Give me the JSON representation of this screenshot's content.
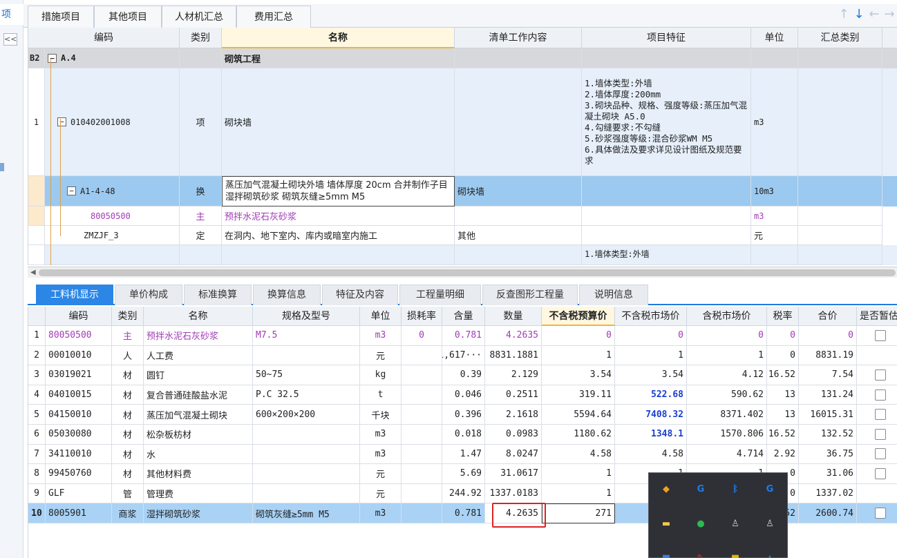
{
  "sidebar": {
    "selected_label": "项",
    "collapse_glyph": "<<",
    "marker_label": ""
  },
  "top_tabs": [
    "措施项目",
    "其他项目",
    "人材机汇总",
    "费用汇总"
  ],
  "nav_arrows": [
    "↑",
    "↓",
    "←",
    "→"
  ],
  "upper_grid": {
    "headers": {
      "code": "编码",
      "type": "类别",
      "name": "名称",
      "work": "清单工作内容",
      "feature": "项目特征",
      "unit": "单位",
      "summary": "汇总类别"
    },
    "rows": [
      {
        "no": "B2",
        "code": "A.4",
        "type": "",
        "name": "砌筑工程",
        "work": "",
        "feature": "",
        "unit": "",
        "summary": ""
      },
      {
        "no": "1",
        "code": "010402001008",
        "type": "项",
        "name": "砌块墙",
        "work": "",
        "feature": "1.墙体类型:外墙\n2.墙体厚度:200mm\n3.砌块品种、规格、强度等级:蒸压加气混凝土砌块 A5.0\n4.勾缝要求:不勾缝\n5.砂浆强度等级:混合砂浆WM M5\n6.具体做法及要求详见设计图纸及规范要求",
        "unit": "m3",
        "summary": ""
      },
      {
        "no": "",
        "code": "A1-4-48",
        "type": "换",
        "name": "蒸压加气混凝土砌块外墙 墙体厚度 20cm 合并制作子目 湿拌砌筑砂浆 砌筑灰缝≥5mm M5",
        "work": "砌块墙",
        "feature": "",
        "unit": "10m3",
        "summary": ""
      },
      {
        "no": "",
        "code": "80050500",
        "type": "主",
        "name": "预拌水泥石灰砂浆",
        "work": "",
        "feature": "",
        "unit": "m3",
        "summary": ""
      },
      {
        "no": "",
        "code": "ZMZJF_3",
        "type": "定",
        "name": "在洞内、地下室内、库内或暗室内施工",
        "work": "其他",
        "feature": "",
        "unit": "元",
        "summary": ""
      },
      {
        "no": "",
        "code": "",
        "type": "",
        "name": "",
        "work": "",
        "feature": "1.墙体类型:外墙",
        "unit": "",
        "summary": ""
      }
    ]
  },
  "lower_tabs": [
    "工料机显示",
    "单价构成",
    "标准换算",
    "换算信息",
    "特征及内容",
    "工程量明细",
    "反查图形工程量",
    "说明信息"
  ],
  "lower_grid": {
    "headers": [
      "",
      "编码",
      "类别",
      "名称",
      "规格及型号",
      "单位",
      "损耗率",
      "含量",
      "数量",
      "不含税预算价",
      "不含税市场价",
      "含税市场价",
      "税率",
      "合价",
      "是否暂估"
    ],
    "rows": [
      {
        "no": "1",
        "code": "80050500",
        "type": "主",
        "name": "预拌水泥石灰砂浆",
        "spec": "M7.5",
        "unit": "m3",
        "loss": "0",
        "qty_per": "0.781",
        "qty": "4.2635",
        "budget": "0",
        "market": "0",
        "market_tax": "0",
        "tax": "0",
        "total": "0",
        "check": true,
        "purple": true
      },
      {
        "no": "2",
        "code": "00010010",
        "type": "人",
        "name": "人工费",
        "spec": "",
        "unit": "元",
        "loss": "",
        "qty_per": "1,617···",
        "qty": "8831.1881",
        "budget": "1",
        "market": "1",
        "market_tax": "1",
        "tax": "0",
        "total": "8831.19",
        "check": false
      },
      {
        "no": "3",
        "code": "03019021",
        "type": "材",
        "name": "圆钉",
        "spec": "50~75",
        "unit": "kg",
        "loss": "",
        "qty_per": "0.39",
        "qty": "2.129",
        "budget": "3.54",
        "market": "3.54",
        "market_tax": "4.12",
        "tax": "16.52",
        "total": "7.54",
        "check": true
      },
      {
        "no": "4",
        "code": "04010015",
        "type": "材",
        "name": "复合普通硅酸盐水泥",
        "spec": "P.C 32.5",
        "unit": "t",
        "loss": "",
        "qty_per": "0.046",
        "qty": "0.2511",
        "budget": "319.11",
        "market": "522.68",
        "market_tax": "590.62",
        "tax": "13",
        "total": "131.24",
        "check": true,
        "market_blue": true
      },
      {
        "no": "5",
        "code": "04150010",
        "type": "材",
        "name": "蒸压加气混凝土砌块",
        "spec": "600×200×200",
        "unit": "千块",
        "loss": "",
        "qty_per": "0.396",
        "qty": "2.1618",
        "budget": "5594.64",
        "market": "7408.32",
        "market_tax": "8371.402",
        "tax": "13",
        "total": "16015.31",
        "check": true,
        "market_blue": true
      },
      {
        "no": "6",
        "code": "05030080",
        "type": "材",
        "name": "松杂板枋材",
        "spec": "",
        "unit": "m3",
        "loss": "",
        "qty_per": "0.018",
        "qty": "0.0983",
        "budget": "1180.62",
        "market": "1348.1",
        "market_tax": "1570.806",
        "tax": "16.52",
        "total": "132.52",
        "check": true,
        "market_blue": true
      },
      {
        "no": "7",
        "code": "34110010",
        "type": "材",
        "name": "水",
        "spec": "",
        "unit": "m3",
        "loss": "",
        "qty_per": "1.47",
        "qty": "8.0247",
        "budget": "4.58",
        "market": "4.58",
        "market_tax": "4.714",
        "tax": "2.92",
        "total": "36.75",
        "check": true
      },
      {
        "no": "8",
        "code": "99450760",
        "type": "材",
        "name": "其他材料费",
        "spec": "",
        "unit": "元",
        "loss": "",
        "qty_per": "5.69",
        "qty": "31.0617",
        "budget": "1",
        "market": "1",
        "market_tax": "1",
        "tax": "0",
        "total": "31.06",
        "check": true
      },
      {
        "no": "9",
        "code": "GLF",
        "type": "管",
        "name": "管理费",
        "spec": "",
        "unit": "元",
        "loss": "",
        "qty_per": "244.92",
        "qty": "1337.0183",
        "budget": "1",
        "market": "1",
        "market_tax": "1",
        "tax": "0",
        "total": "1337.02",
        "check": false
      },
      {
        "no": "10",
        "code": "8005901",
        "type": "商浆",
        "name": "湿拌砌筑砂浆",
        "spec": "砌筑灰缝≥5mm M5",
        "unit": "m3",
        "loss": "",
        "qty_per": "0.781",
        "qty": "4.2635",
        "budget": "271",
        "market": "",
        "market_tax": "",
        "tax": "52",
        "total": "2600.74",
        "check": true,
        "selected": true
      }
    ]
  },
  "tray_icons": [
    {
      "name": "shield-icon",
      "color": "#f0a020",
      "glyph": "◆"
    },
    {
      "name": "g-logo-icon",
      "color": "#1e7be8",
      "glyph": "G"
    },
    {
      "name": "bluetooth-icon",
      "color": "#1e7be8",
      "glyph": "ᛒ"
    },
    {
      "name": "g-app-icon",
      "color": "#1e7be8",
      "glyph": "G"
    },
    {
      "name": "folder-icon",
      "color": "#f2c84b",
      "glyph": "▬"
    },
    {
      "name": "wechat-icon",
      "color": "#2dbb4d",
      "glyph": "●"
    },
    {
      "name": "user-icon",
      "color": "#cfcfcf",
      "glyph": "♙"
    },
    {
      "name": "user-icon",
      "color": "#cfcfcf",
      "glyph": "♙"
    },
    {
      "name": "app-icon",
      "color": "#3b7fe0",
      "glyph": "■"
    },
    {
      "name": "pen-icon",
      "color": "#e03030",
      "glyph": "✎"
    },
    {
      "name": "app-icon",
      "color": "#f0b000",
      "glyph": "■"
    },
    {
      "name": "app-icon",
      "color": "#2080e0",
      "glyph": "▲"
    }
  ],
  "colors": {
    "accent": "#2b86e6",
    "selection": "#a9d2f5",
    "highlight_header": "#fff7e0",
    "purple": "#a03bb4",
    "red_box": "#e02020"
  }
}
